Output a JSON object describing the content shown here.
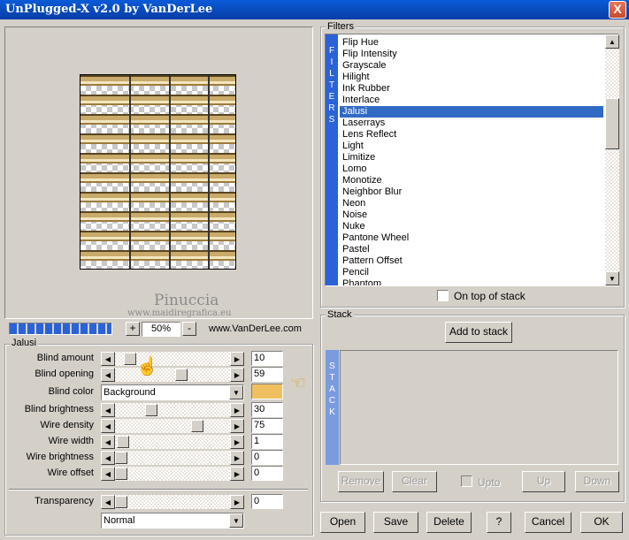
{
  "window": {
    "title": "UnPlugged-X v2.0 by VanDerLee",
    "close_symbol": "X"
  },
  "preview": {
    "watermark_line1": "Pinuccia",
    "watermark_line2": "www.maidiregrafica.eu",
    "zoom": "50%",
    "zoom_plus": "+",
    "zoom_minus": "-",
    "url": "www.VanDerLee.com"
  },
  "params": {
    "group_label": "Jalusi",
    "rows": [
      {
        "label": "Blind amount",
        "value": "10"
      },
      {
        "label": "Blind opening",
        "value": "59"
      },
      {
        "label": "Blind color",
        "value": "Background",
        "color": "#f0c060"
      },
      {
        "label": "Blind brightness",
        "value": "30"
      },
      {
        "label": "Wire density",
        "value": "75"
      },
      {
        "label": "Wire width",
        "value": "1"
      },
      {
        "label": "Wire brightness",
        "value": "0"
      },
      {
        "label": "Wire offset",
        "value": "0"
      }
    ],
    "transparency": {
      "label": "Transparency",
      "value": "0"
    },
    "blend_mode": "Normal"
  },
  "filters": {
    "group_label": "Filters",
    "strip_letters": [
      "F",
      "I",
      "L",
      "T",
      "E",
      "R",
      "S"
    ],
    "items": [
      "Flip Hue",
      "Flip Intensity",
      "Grayscale",
      "Hilight",
      "Ink Rubber",
      "Interlace",
      "Jalusi",
      "Laserrays",
      "Lens Reflect",
      "Light",
      "Limitize",
      "Lomo",
      "Monotize",
      "Neighbor Blur",
      "Neon",
      "Noise",
      "Nuke",
      "Pantone Wheel",
      "Pastel",
      "Pattern Offset",
      "Pencil",
      "Phantom"
    ],
    "selected": "Jalusi",
    "on_top_label": "On top of stack"
  },
  "stack": {
    "group_label": "Stack",
    "add_label": "Add to stack",
    "strip_letters": [
      "S",
      "T",
      "A",
      "C",
      "K"
    ],
    "remove_label": "Remove",
    "clear_label": "Clear",
    "upto_label": "Upto",
    "up_label": "Up",
    "down_label": "Down"
  },
  "footer": {
    "open": "Open",
    "save": "Save",
    "delete": "Delete",
    "help": "?",
    "cancel": "Cancel",
    "ok": "OK"
  }
}
